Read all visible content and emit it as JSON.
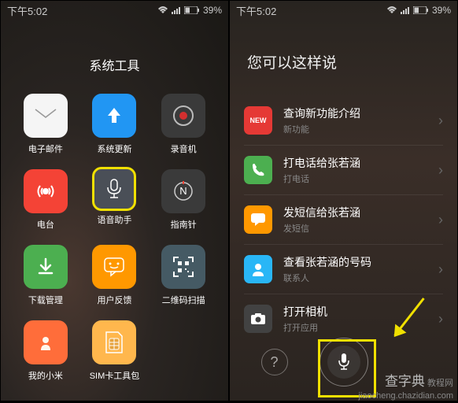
{
  "status": {
    "time": "下午5:02",
    "battery": "39%"
  },
  "left_phone": {
    "folder_title": "系统工具",
    "apps": [
      {
        "label": "电子邮件",
        "color": "#f5f5f5",
        "icon": "mail"
      },
      {
        "label": "系统更新",
        "color": "#2196f3",
        "icon": "update"
      },
      {
        "label": "录音机",
        "color": "#3a3a3a",
        "icon": "rec"
      },
      {
        "label": "电台",
        "color": "#f44336",
        "icon": "radio"
      },
      {
        "label": "语音助手",
        "color": "#4a4f57",
        "icon": "mic",
        "highlighted": true
      },
      {
        "label": "指南针",
        "color": "#3a3a3a",
        "icon": "compass"
      },
      {
        "label": "下载管理",
        "color": "#4caf50",
        "icon": "download"
      },
      {
        "label": "用户反馈",
        "color": "#ff9800",
        "icon": "feedback"
      },
      {
        "label": "二维码扫描",
        "color": "#455a64",
        "icon": "qr"
      },
      {
        "label": "我的小米",
        "color": "#ff6d3a",
        "icon": "mi"
      },
      {
        "label": "SIM卡工具包",
        "color": "#ffb74d",
        "icon": "sim"
      }
    ]
  },
  "right_phone": {
    "title": "您可以这样说",
    "items": [
      {
        "main": "查询新功能介绍",
        "sub": "新功能",
        "badge": "NEW",
        "color": "#e53935"
      },
      {
        "main": "打电话给张若涵",
        "sub": "打电话",
        "icon": "phone",
        "color": "#4caf50"
      },
      {
        "main": "发短信给张若涵",
        "sub": "发短信",
        "icon": "sms",
        "color": "#ff9800"
      },
      {
        "main": "查看张若涵的号码",
        "sub": "联系人",
        "icon": "contact",
        "color": "#29b6f6"
      },
      {
        "main": "打开相机",
        "sub": "打开应用",
        "icon": "camera",
        "color": "#424242"
      }
    ]
  },
  "watermark": {
    "line1": "查字典",
    "line2": "教程网",
    "url": "jiaocheng.chazidian.com"
  }
}
